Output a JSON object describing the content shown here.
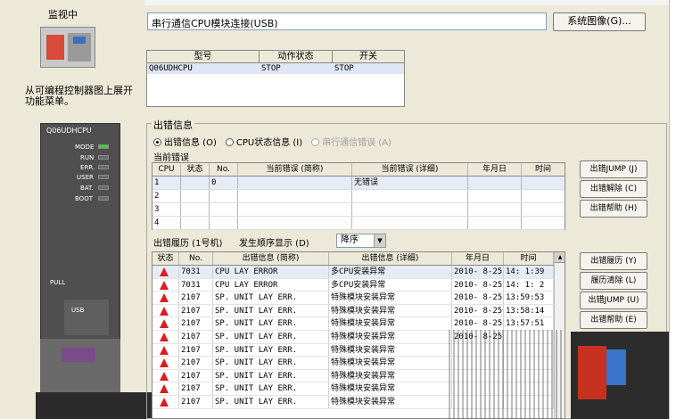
{
  "left": {
    "monitor_label": "监视中",
    "description": "从可编程控制器图上展开功能菜单。",
    "plc_model": "Q06UDHCPU",
    "led_labels": [
      "MODE",
      "RUN",
      "ERR.",
      "USER",
      "BAT.",
      "BOOT"
    ],
    "pull_label": "PULL",
    "usb_label": "USB"
  },
  "connection": {
    "path": "串行通信CPU模块连接(USB)",
    "system_image_button": "系统图像(G)..."
  },
  "status_table": {
    "headers": [
      "型号",
      "动作状态",
      "开关"
    ],
    "row": [
      "Q06UDHCPU",
      "STOP",
      "STOP"
    ]
  },
  "error_info": {
    "group_title": "出错信息",
    "radios": [
      {
        "label": "出错信息 (O)",
        "selected": true,
        "enabled": true
      },
      {
        "label": "CPU状态信息 (I)",
        "selected": false,
        "enabled": true
      },
      {
        "label": "串行通信错误 (A)",
        "selected": false,
        "enabled": false
      }
    ],
    "current_title": "当前错误",
    "current_headers": [
      "CPU",
      "状态",
      "No.",
      "当前错误 (简称)",
      "当前错误 (详细)",
      "年月日",
      "时间"
    ],
    "current_rows": [
      [
        "1",
        "",
        "0",
        "",
        "无错误",
        "",
        ""
      ],
      [
        "2",
        "",
        "",
        "",
        "",
        "",
        ""
      ],
      [
        "3",
        "",
        "",
        "",
        "",
        "",
        ""
      ],
      [
        "4",
        "",
        "",
        "",
        "",
        "",
        ""
      ]
    ],
    "current_buttons": [
      "出错JUMP (J)",
      "出错解除 (C)",
      "出错帮助 (H)"
    ]
  },
  "history": {
    "title": "出错履历 (1号机)",
    "order_label": "发生顺序显示 (D)",
    "order_value": "降序",
    "headers": [
      "状态",
      "No.",
      "出错信息 (简称)",
      "出错信息 (详细)",
      "年月日",
      "时间"
    ],
    "rows": [
      [
        "7031",
        "CPU LAY ERROR",
        "多CPU安装异常",
        "2010- 8-25",
        "14: 1:39"
      ],
      [
        "7031",
        "CPU LAY ERROR",
        "多CPU安装异常",
        "2010- 8-25",
        "14: 1: 2"
      ],
      [
        "2107",
        "SP. UNIT LAY ERR.",
        "特殊模块安装异常",
        "2010- 8-25",
        "13:59:53"
      ],
      [
        "2107",
        "SP. UNIT LAY ERR.",
        "特殊模块安装异常",
        "2010- 8-25",
        "13:58:14"
      ],
      [
        "2107",
        "SP. UNIT LAY ERR.",
        "特殊模块安装异常",
        "2010- 8-25",
        "13:57:51"
      ],
      [
        "2107",
        "SP. UNIT LAY ERR.",
        "特殊模块安装异常",
        "2010- 8-25",
        ""
      ],
      [
        "2107",
        "SP. UNIT LAY ERR.",
        "特殊模块安装异常",
        "",
        ""
      ],
      [
        "2107",
        "SP. UNIT LAY ERR.",
        "特殊模块安装异常",
        "",
        ""
      ],
      [
        "2107",
        "SP. UNIT LAY ERR.",
        "特殊模块安装异常",
        "",
        ""
      ],
      [
        "2107",
        "SP. UNIT LAY ERR.",
        "特殊模块安装异常",
        "",
        ""
      ],
      [
        "2107",
        "SP. UNIT LAY ERR.",
        "特殊模块安装异常",
        "",
        ""
      ]
    ],
    "buttons": [
      "出错履历 (Y)",
      "履历清除 (L)",
      "出错JUMP (U)",
      "出错帮助 (E)"
    ]
  },
  "colors": {
    "window_bg": "#ece9d8",
    "selection": "#e6ecf6",
    "warning": "#d81e1e",
    "led_green": "#36d23a"
  }
}
